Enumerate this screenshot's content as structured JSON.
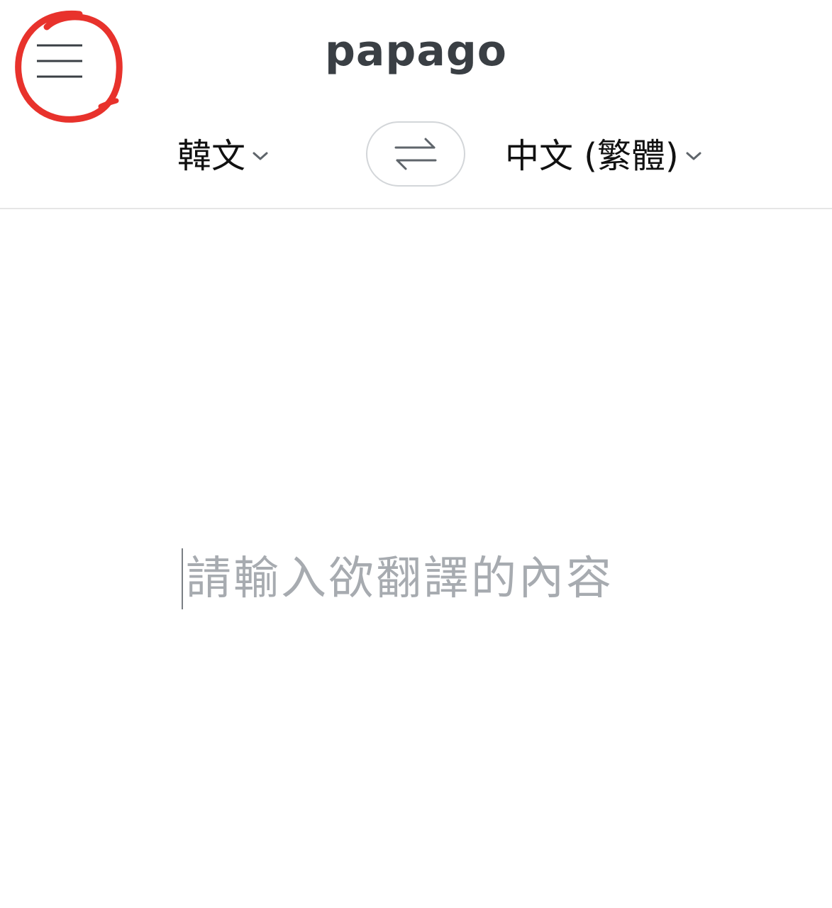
{
  "header": {
    "logo_text": "papago"
  },
  "language_bar": {
    "source_language": "韓文",
    "target_language": "中文 (繁體)",
    "swap_icon": "swap-arrows-icon",
    "chevron_icon": "chevron-down-icon"
  },
  "menu": {
    "icon": "hamburger-menu-icon",
    "annotation_color": "#e8322c"
  },
  "input": {
    "placeholder": "請輸入欲翻譯的內容"
  },
  "colors": {
    "logo": "#3a3f44",
    "placeholder": "#a7abb0",
    "annotation": "#e8322c"
  }
}
